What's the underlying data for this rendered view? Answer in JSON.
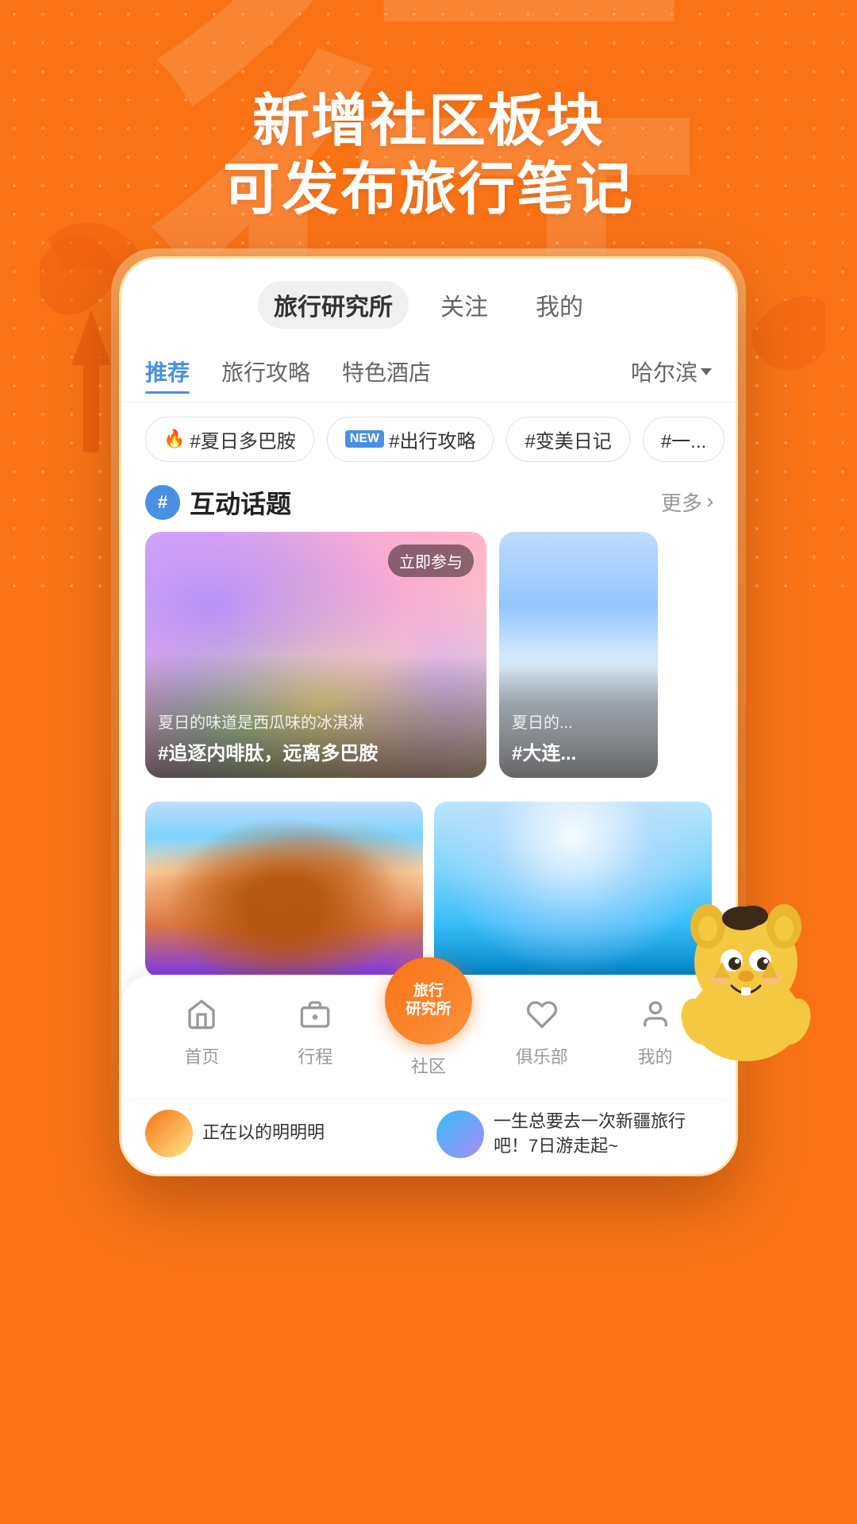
{
  "app": {
    "title": "旅行研究所",
    "hero_line1": "新增社区板块",
    "hero_line2": "可发布旅行笔记"
  },
  "phone": {
    "main_tabs": [
      {
        "label": "旅行研究所",
        "active": true
      },
      {
        "label": "关注",
        "active": false
      },
      {
        "label": "我的",
        "active": false
      }
    ],
    "sub_tabs": [
      {
        "label": "推荐",
        "active": true
      },
      {
        "label": "旅行攻略",
        "active": false
      },
      {
        "label": "特色酒店",
        "active": false
      },
      {
        "label": "哈尔滨",
        "active": false,
        "has_arrow": true
      }
    ],
    "tag_pills": [
      {
        "icon": "fire",
        "label": "#夏日多巴胺"
      },
      {
        "icon": "new",
        "label": "#出行攻略"
      },
      {
        "icon": "none",
        "label": "#变美日记"
      },
      {
        "icon": "none",
        "label": "#一..."
      }
    ],
    "section": {
      "icon": "#",
      "title": "互动话题",
      "more_label": "更多"
    },
    "topic_cards": [
      {
        "id": "card1",
        "badge": "立即参与",
        "subtitle": "夏日的味道是西瓜味的冰淇淋",
        "tag": "#追逐内啡肽，远离多巴胺"
      },
      {
        "id": "card2",
        "subtitle": "夏日的...",
        "tag": "#大连..."
      }
    ],
    "grid_items": [
      {
        "id": "grid1",
        "type": "temple"
      },
      {
        "id": "grid2",
        "type": "jump"
      }
    ]
  },
  "bottom_nav": {
    "items": [
      {
        "id": "home",
        "label": "首页",
        "icon": "home"
      },
      {
        "id": "trip",
        "label": "行程",
        "icon": "trip"
      },
      {
        "id": "community",
        "label": "社区",
        "icon": "center",
        "center": true
      },
      {
        "id": "club",
        "label": "俱乐部",
        "icon": "club"
      },
      {
        "id": "profile",
        "label": "我的",
        "icon": "profile"
      }
    ],
    "center_label_line1": "旅行",
    "center_label_line2": "研究所"
  },
  "bottom_strip": {
    "items": [
      {
        "text": "正在以的明明明"
      },
      {
        "text": "一生总要去一次新疆旅行吧！7日游走起~"
      }
    ]
  }
}
